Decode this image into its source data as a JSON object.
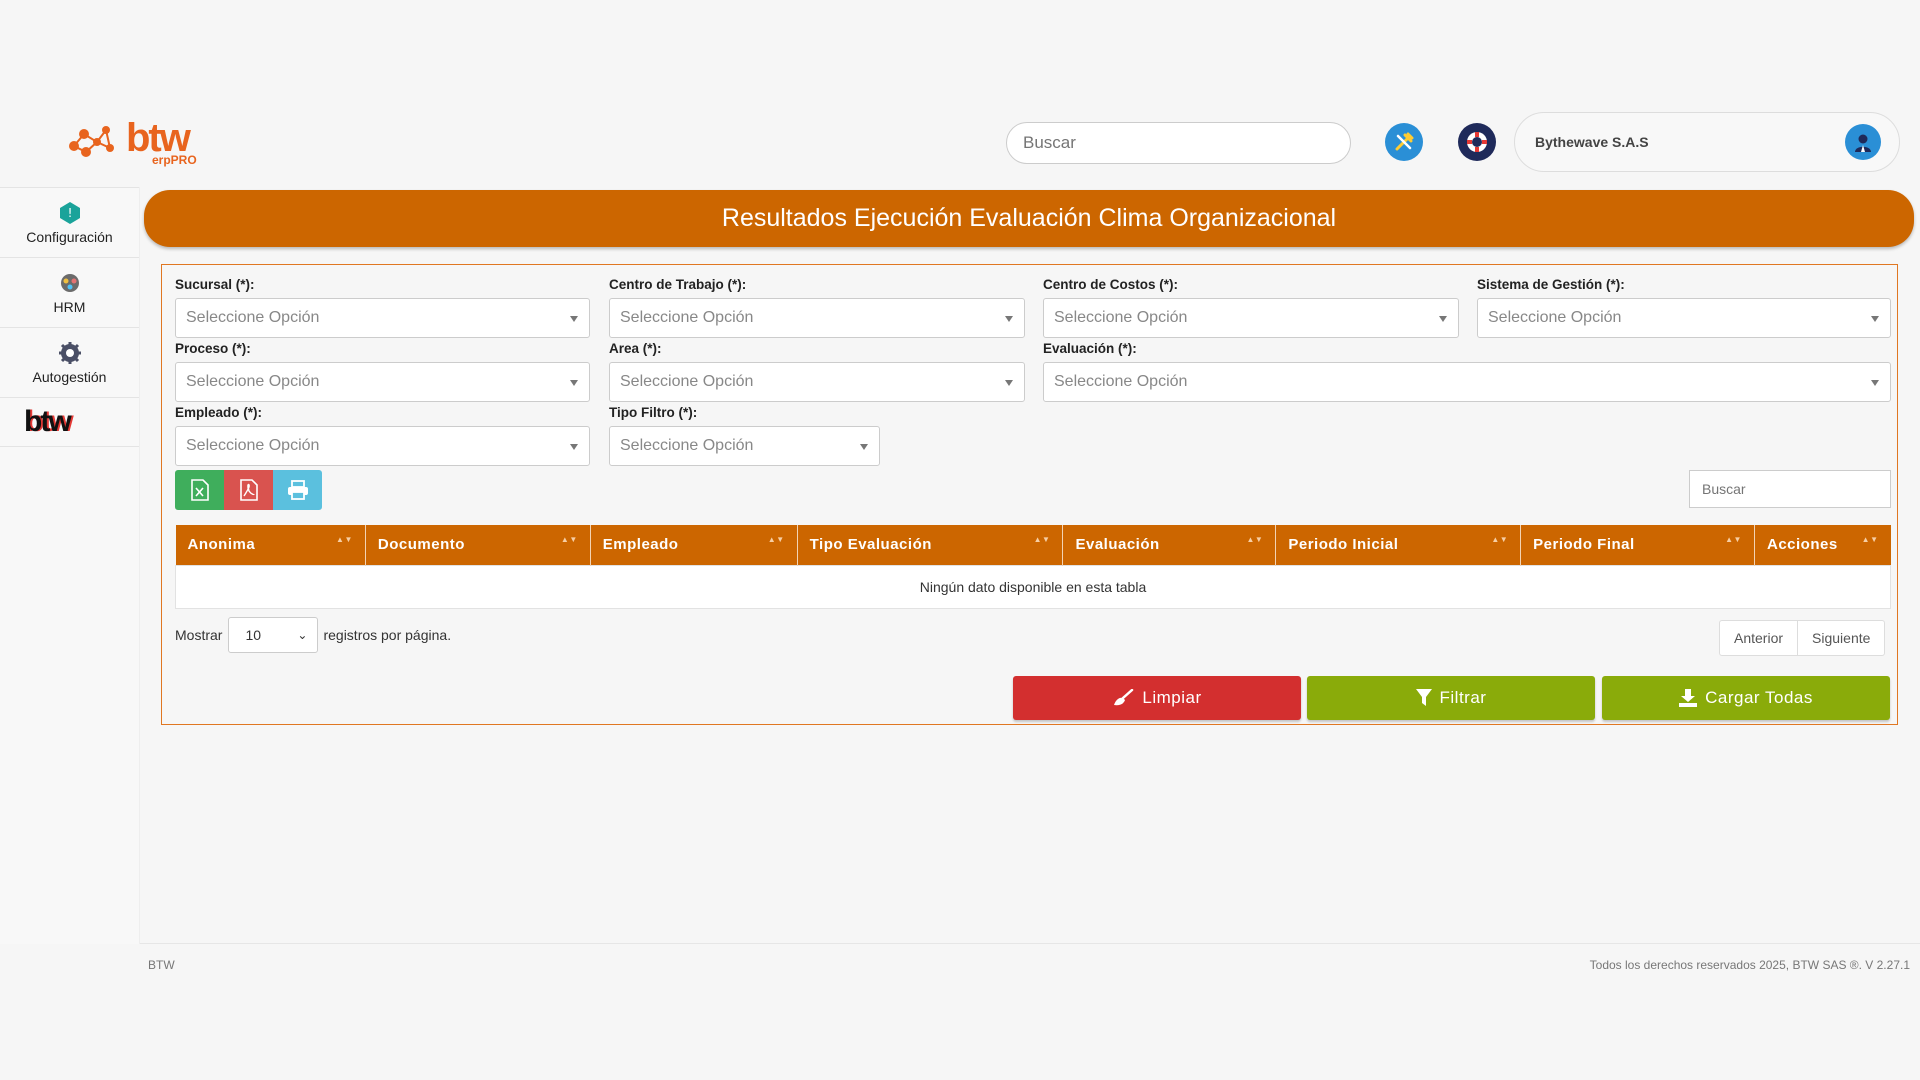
{
  "header": {
    "logo_text": "btw",
    "logo_sub": "erpPRO",
    "search_placeholder": "Buscar",
    "company_name": "Bythewave S.A.S"
  },
  "sidebar": {
    "items": [
      {
        "label": "Configuración",
        "icon": "config-icon"
      },
      {
        "label": "HRM",
        "icon": "hrm-icon"
      },
      {
        "label": "Autogestión",
        "icon": "autogestion-icon"
      }
    ],
    "brand": "btw"
  },
  "page_title": "Resultados Ejecución Evaluación Clima Organizacional",
  "filters": {
    "sucursal": {
      "label": "Sucursal (*):",
      "value": "Seleccione Opción"
    },
    "centro_trabajo": {
      "label": "Centro de Trabajo (*):",
      "value": "Seleccione Opción"
    },
    "centro_costos": {
      "label": "Centro de Costos (*):",
      "value": "Seleccione Opción"
    },
    "sistema_gestion": {
      "label": "Sistema de Gestión (*):",
      "value": "Seleccione Opción"
    },
    "proceso": {
      "label": "Proceso (*):",
      "value": "Seleccione Opción"
    },
    "area": {
      "label": "Area (*):",
      "value": "Seleccione Opción"
    },
    "evaluacion": {
      "label": "Evaluación (*):",
      "value": "Seleccione Opción"
    },
    "empleado": {
      "label": "Empleado (*):",
      "value": "Seleccione Opción"
    },
    "tipo_filtro": {
      "label": "Tipo Filtro (*):",
      "value": "Seleccione Opción"
    }
  },
  "table": {
    "search_placeholder": "Buscar",
    "columns": [
      "Anonima",
      "Documento",
      "Empleado",
      "Tipo Evaluación",
      "Evaluación",
      "Periodo Inicial",
      "Periodo Final",
      "Acciones"
    ],
    "empty_message": "Ningún dato disponible en esta tabla"
  },
  "pagination": {
    "show_label": "Mostrar",
    "page_size": "10",
    "per_page_label": "registros por página.",
    "prev": "Anterior",
    "next": "Siguiente"
  },
  "actions": {
    "clear": "Limpiar",
    "filter": "Filtrar",
    "load_all": "Cargar Todas"
  },
  "footer": {
    "left": "BTW",
    "right": "Todos los derechos reservados 2025, BTW SAS ®. V 2.27.1"
  },
  "colors": {
    "accent": "#cc6600",
    "danger": "#d32f2f",
    "success": "#8aab0a"
  }
}
